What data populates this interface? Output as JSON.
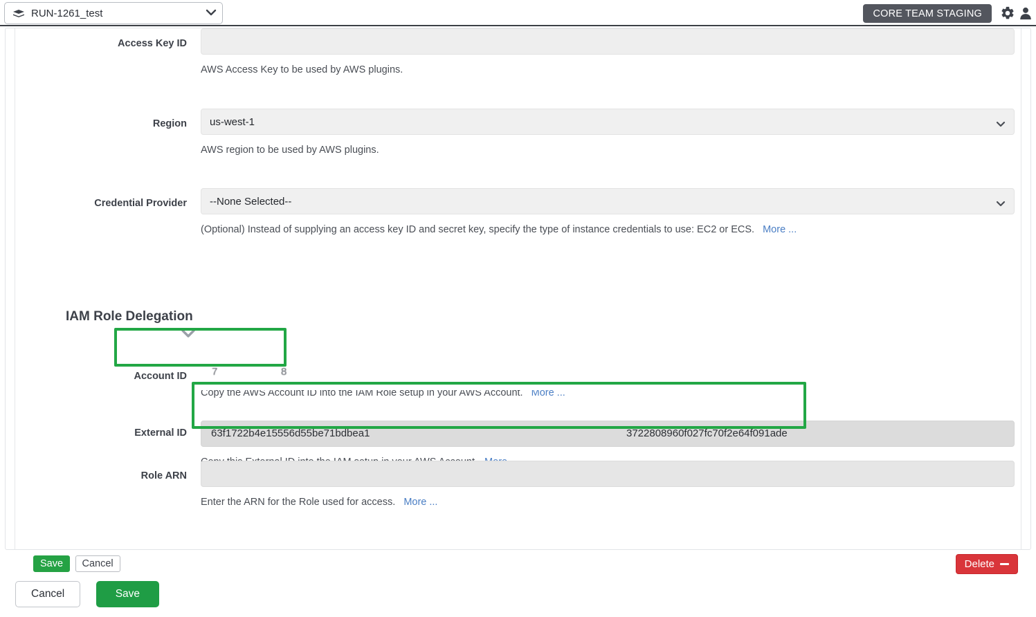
{
  "topbar": {
    "app_name": "RUN-1261_test",
    "app_icon": "boxes-icon",
    "chevron_icon": "chevron-down-icon",
    "env_badge": "CORE TEAM STAGING",
    "gear_icon": "gear-icon",
    "user_icon": "user-icon"
  },
  "form": {
    "fields": [
      {
        "label": "Access Key ID",
        "type": "text",
        "value": "",
        "placeholder": "",
        "help": "AWS Access Key to be used by AWS plugins.",
        "more_label": ""
      },
      {
        "label": "Region",
        "type": "select",
        "value": "us-west-1",
        "help": "AWS region to be used by AWS plugins.",
        "more_label": ""
      },
      {
        "label": "Credential Provider",
        "type": "select",
        "value": "--None Selected--",
        "help": "(Optional) Instead of supplying an access key ID and secret key, specify the type of instance credentials to use: EC2 or ECS.",
        "more_label": "More ..."
      }
    ]
  },
  "section": {
    "title": "IAM Role Delegation",
    "collapse_icon": "chevron-down-icon"
  },
  "iam": {
    "account_id": {
      "label": "Account ID",
      "value_start": "7",
      "value_end": "8",
      "help": "Copy the AWS Account ID into the IAM Role setup in your AWS Account.",
      "more_label": "More ..."
    },
    "external_id": {
      "label": "External ID",
      "value_start": "63f1722b4e15556d55be71bdbea1",
      "value_end": "3722808960f027fc70f2e64f091ade",
      "help": "Copy this External ID into the IAM setup in your AWS Account.",
      "more_label": "More ..."
    },
    "role_arn": {
      "label": "Role ARN",
      "value": "",
      "help": "Enter the ARN for the Role used for access.",
      "more_label": "More ..."
    }
  },
  "inline_actions": {
    "save_label": "Save",
    "cancel_label": "Cancel",
    "delete_label": "Delete",
    "delete_icon": "minus-icon"
  },
  "footer": {
    "cancel_label": "Cancel",
    "save_label": "Save"
  },
  "colors": {
    "highlight_green": "#22a745",
    "save_green": "#1f9d45",
    "delete_red": "#d9353a",
    "link_blue": "#4a7ec4",
    "badge_gray": "#53565e"
  }
}
